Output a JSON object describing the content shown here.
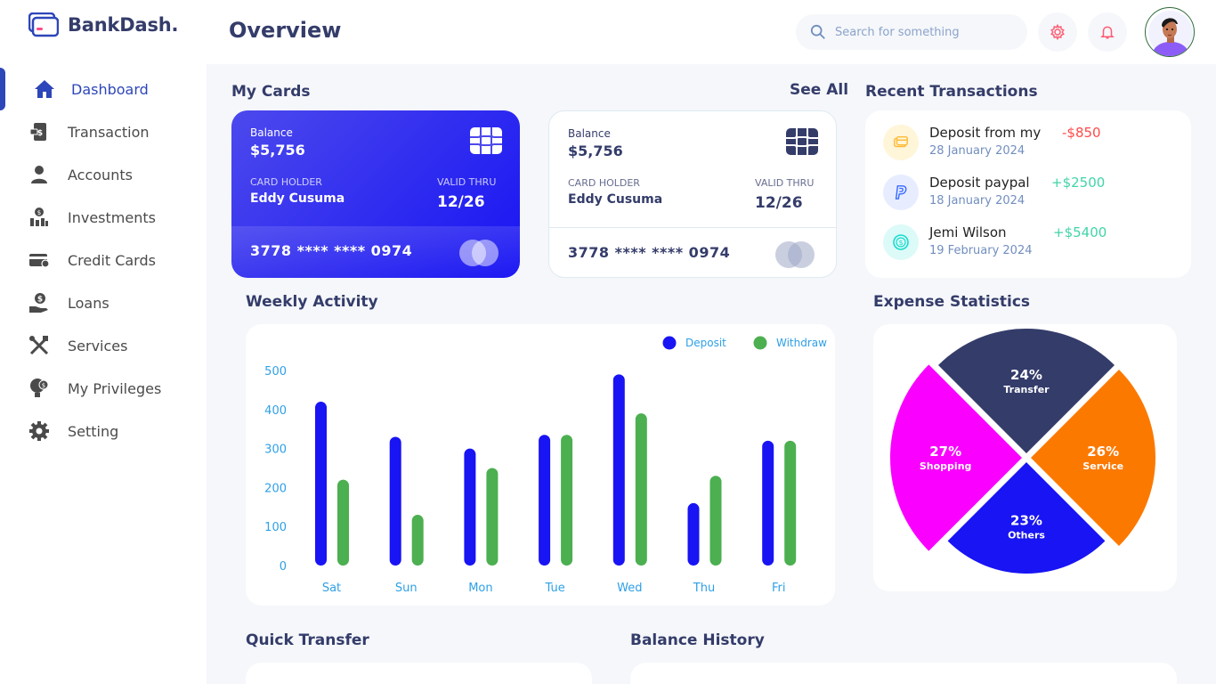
{
  "app": {
    "name": "BankDash."
  },
  "sidebar": {
    "items": [
      {
        "label": "Dashboard",
        "icon": "home-icon"
      },
      {
        "label": "Transaction",
        "icon": "transfer-icon"
      },
      {
        "label": "Accounts",
        "icon": "user-icon"
      },
      {
        "label": "Investments",
        "icon": "investment-icon"
      },
      {
        "label": "Credit Cards",
        "icon": "credit-card-icon"
      },
      {
        "label": "Loans",
        "icon": "loan-icon"
      },
      {
        "label": "Services",
        "icon": "service-icon"
      },
      {
        "label": "My Privileges",
        "icon": "privilege-icon"
      },
      {
        "label": "Setting",
        "icon": "gear-icon"
      }
    ],
    "active": "Dashboard"
  },
  "header": {
    "title": "Overview",
    "search_placeholder": "Search for something"
  },
  "my_cards": {
    "title": "My Cards",
    "see_all": "See All",
    "cards": [
      {
        "balance_label": "Balance",
        "balance": "$5,756",
        "holder_label": "CARD HOLDER",
        "holder": "Eddy Cusuma",
        "valid_label": "VALID THRU",
        "valid": "12/26",
        "number": "3778 **** **** 0974"
      },
      {
        "balance_label": "Balance",
        "balance": "$5,756",
        "holder_label": "CARD HOLDER",
        "holder": "Eddy Cusuma",
        "valid_label": "VALID THRU",
        "valid": "12/26",
        "number": "3778 **** **** 0974"
      }
    ]
  },
  "recent_transactions": {
    "title": "Recent Transactions",
    "items": [
      {
        "name": "Deposit from my",
        "date": "28 January 2024",
        "amount": "-$850",
        "icon": "card-icon"
      },
      {
        "name": "Deposit paypal",
        "date": "18 January 2024",
        "amount": "+$2500",
        "icon": "paypal-icon"
      },
      {
        "name": "Jemi Wilson",
        "date": "19 February 2024",
        "amount": "+$5400",
        "icon": "dollar-coin-icon"
      }
    ]
  },
  "weekly_activity": {
    "title": "Weekly Activity"
  },
  "expense_statistics": {
    "title": "Expense Statistics"
  },
  "quick_transfer": {
    "title": "Quick Transfer"
  },
  "balance_history": {
    "title": "Balance History"
  },
  "colors": {
    "deposit": "#1814f3",
    "withdraw": "#4caf50",
    "negative": "#ff4b4a",
    "positive": "#16dbaa"
  },
  "chart_data": [
    {
      "type": "bar",
      "categories": [
        "Sat",
        "Sun",
        "Mon",
        "Tue",
        "Wed",
        "Thu",
        "Fri"
      ],
      "series": [
        {
          "name": "Deposit",
          "values": [
            420,
            330,
            300,
            335,
            490,
            160,
            320
          ]
        },
        {
          "name": "Withdraw",
          "values": [
            220,
            130,
            250,
            335,
            390,
            230,
            320
          ]
        }
      ],
      "yticks": [
        "500",
        "400",
        "300",
        "200",
        "100",
        "0"
      ],
      "ylim": [
        0,
        500
      ],
      "legend": "top-right",
      "grid": false
    },
    {
      "type": "pie",
      "labels": [
        "Transfer",
        "Service",
        "Others",
        "Shopping"
      ],
      "values": [
        24,
        26,
        23,
        27
      ],
      "display": [
        "24%",
        "26%",
        "23%",
        "27%"
      ],
      "colors": [
        "#343c6a",
        "#fc7900",
        "#1814f3",
        "#fa00ff"
      ]
    }
  ]
}
